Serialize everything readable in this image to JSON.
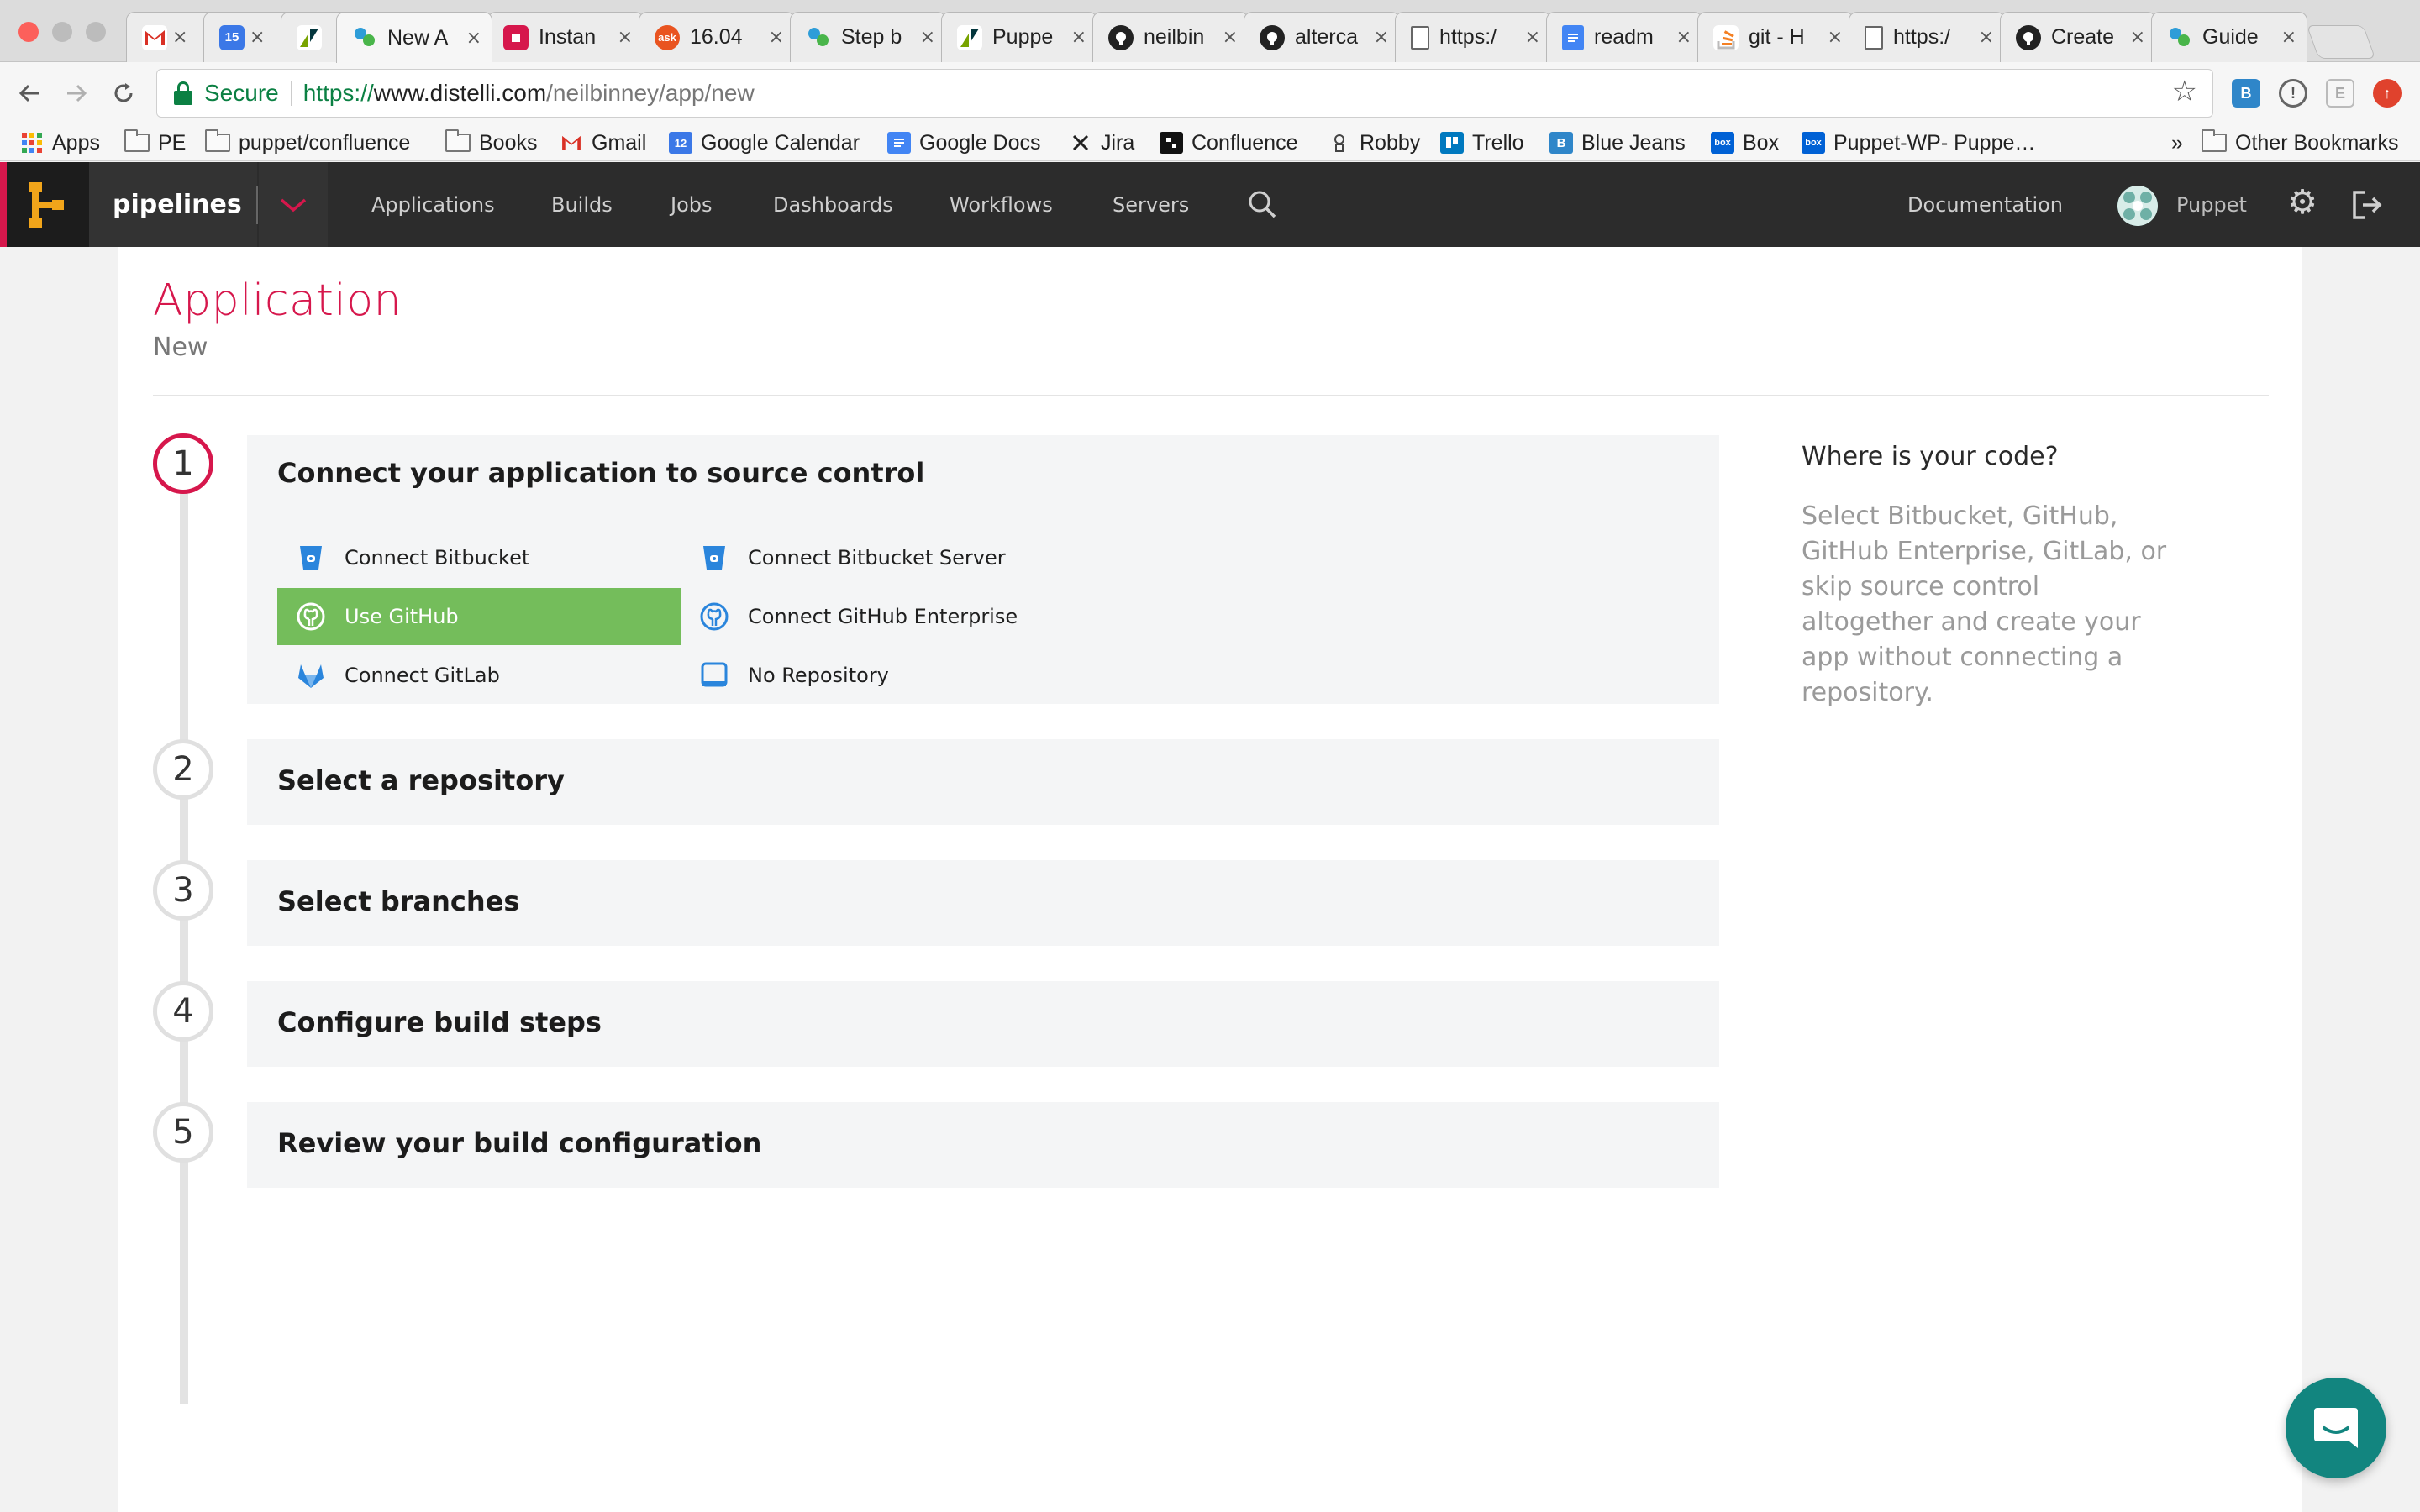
{
  "browser": {
    "tabs": [
      {
        "title": "",
        "favicon": "gmail-icon",
        "color": "#d93025"
      },
      {
        "title": "",
        "favicon": "calendar-icon",
        "color": "#3b78e7"
      },
      {
        "title": "",
        "favicon": "zendesk-icon",
        "color": "#78a300"
      },
      {
        "title": "New A",
        "favicon": "distelli-icon",
        "color": "#2e9dd8",
        "active": true
      },
      {
        "title": "Instan",
        "favicon": "instana-icon",
        "color": "#d6174c"
      },
      {
        "title": "16.04",
        "favicon": "askubuntu-icon",
        "color": "#e95420"
      },
      {
        "title": "Step b",
        "favicon": "distelli-icon",
        "color": "#2e9dd8"
      },
      {
        "title": "Puppe",
        "favicon": "zendesk-icon",
        "color": "#78a300"
      },
      {
        "title": "neilbin",
        "favicon": "github-icon",
        "color": "#222222"
      },
      {
        "title": "alterca",
        "favicon": "github-icon",
        "color": "#222222"
      },
      {
        "title": "https:/",
        "favicon": "page-icon",
        "color": "#ffffff"
      },
      {
        "title": "readm",
        "favicon": "docs-icon",
        "color": "#4285f4"
      },
      {
        "title": "git - H",
        "favicon": "stackoverflow-icon",
        "color": "#f48024"
      },
      {
        "title": "https:/",
        "favicon": "page-icon",
        "color": "#ffffff"
      },
      {
        "title": "Create",
        "favicon": "github-icon",
        "color": "#222222"
      },
      {
        "title": "Guide",
        "favicon": "distelli-icon",
        "color": "#2e9dd8"
      }
    ],
    "tab_close_glyph": "×",
    "secure_label": "Secure",
    "url_scheme": "https://",
    "url_host": "www.distelli.com",
    "url_path": "/neilbinney/app/new",
    "bookmarks": [
      {
        "label": "Apps",
        "icon": "apps-grid-icon"
      },
      {
        "label": "PE",
        "icon": "folder-icon"
      },
      {
        "label": "puppet/confluence",
        "icon": "folder-icon"
      },
      {
        "label": "Books",
        "icon": "folder-icon"
      },
      {
        "label": "Gmail",
        "icon": "gmail-icon"
      },
      {
        "label": "Google Calendar",
        "icon": "calendar-icon"
      },
      {
        "label": "Google Docs",
        "icon": "docs-icon"
      },
      {
        "label": "Jira",
        "icon": "jira-icon"
      },
      {
        "label": "Confluence",
        "icon": "confluence-icon"
      },
      {
        "label": "Robby",
        "icon": "robby-icon"
      },
      {
        "label": "Trello",
        "icon": "trello-icon"
      },
      {
        "label": "Blue Jeans",
        "icon": "bluejeans-icon"
      },
      {
        "label": "Box",
        "icon": "box-icon"
      },
      {
        "label": "Puppet-WP- Puppe…",
        "icon": "box-icon"
      }
    ],
    "bookmarks_overflow": "»",
    "other_bookmarks": "Other Bookmarks",
    "calendar_day": "15",
    "calendar_bm_day": "12"
  },
  "app": {
    "brand": "pipelines",
    "nav": [
      "Applications",
      "Builds",
      "Jobs",
      "Dashboards",
      "Workflows",
      "Servers"
    ],
    "documentation": "Documentation",
    "user": "Puppet",
    "accent": "#d6174c"
  },
  "page": {
    "title": "Application",
    "subtitle": "New",
    "steps": [
      {
        "number": "1",
        "title": "Connect your application to source control",
        "active": true
      },
      {
        "number": "2",
        "title": "Select a repository"
      },
      {
        "number": "3",
        "title": "Select branches"
      },
      {
        "number": "4",
        "title": "Configure build steps"
      },
      {
        "number": "5",
        "title": "Review your build configuration"
      }
    ],
    "source_options": [
      {
        "label": "Connect Bitbucket",
        "icon": "bitbucket-icon"
      },
      {
        "label": "Connect Bitbucket Server",
        "icon": "bitbucket-server-icon"
      },
      {
        "label": "Use GitHub",
        "icon": "github-icon",
        "selected": true
      },
      {
        "label": "Connect GitHub Enterprise",
        "icon": "github-enterprise-icon"
      },
      {
        "label": "Connect GitLab",
        "icon": "gitlab-icon"
      },
      {
        "label": "No Repository",
        "icon": "no-repository-icon"
      }
    ],
    "selected_color": "#74bd5b",
    "help_title": "Where is your code?",
    "help_body": "Select Bitbucket, GitHub, GitHub Enterprise, GitLab, or skip source control altogether and create your app without connecting a repository."
  }
}
